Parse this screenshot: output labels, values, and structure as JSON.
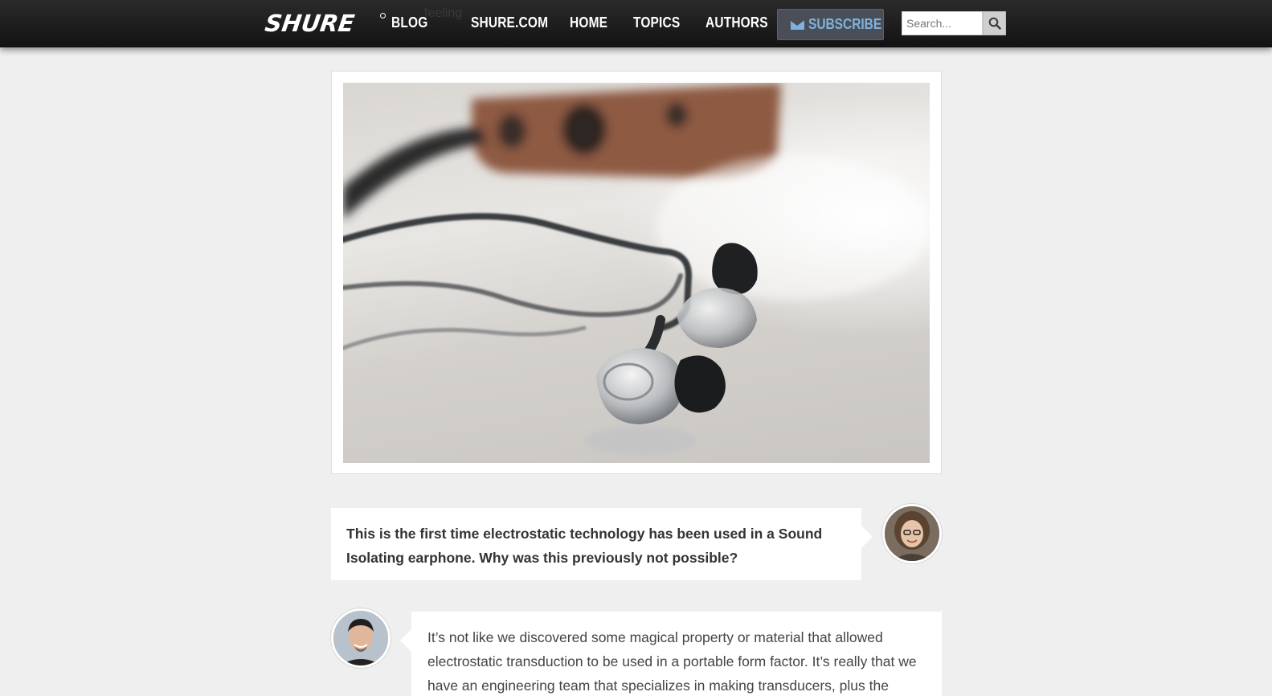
{
  "header": {
    "logo": "SHURE",
    "blog_label": "BLOG",
    "ghost_text": "feeling",
    "nav": [
      {
        "label": "SHURE.COM"
      },
      {
        "label": "HOME"
      },
      {
        "label": "TOPICS"
      },
      {
        "label": "AUTHORS"
      }
    ],
    "subscribe_label": "SUBSCRIBE",
    "search_placeholder": "Search...",
    "search_value": ""
  },
  "interview": {
    "question": "This is the first time electrostatic technology has been used in a Sound Isolating earphone. Why was this previously not possible?",
    "answer": "It’s not like we discovered some magical property or material that allowed electrostatic transduction to be used in a portable form factor. It’s really that we have an engineering team that specializes in making transducers, plus the"
  },
  "colors": {
    "accent": "#7fb2e0",
    "header_bg": "#1a1a1a",
    "page_bg": "#efefef"
  },
  "icons": {
    "search": "magnifier-icon",
    "subscribe": "envelope-icon"
  }
}
